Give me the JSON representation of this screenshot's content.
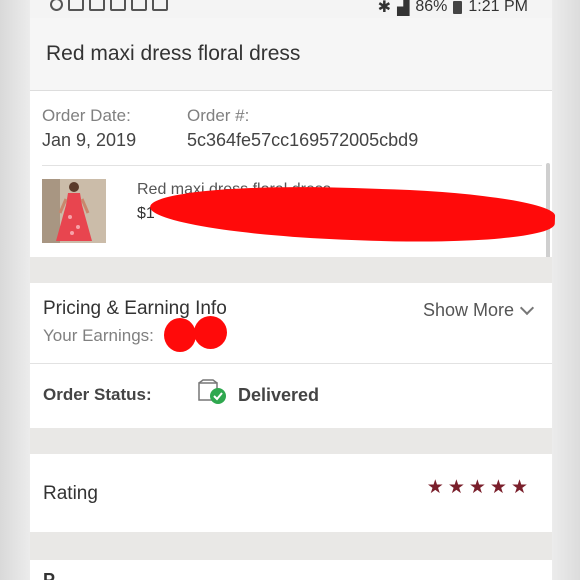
{
  "status_bar": {
    "battery": "86%",
    "time": "1:21 PM"
  },
  "header": {
    "title": "Red maxi dress floral dress"
  },
  "order": {
    "date_label": "Order Date:",
    "date_value": "Jan 9, 2019",
    "number_label": "Order #:",
    "number_value": "5c364fe57cc169572005cbd9",
    "item_name": "Red maxi dress floral dress",
    "item_price_visible": "$1"
  },
  "pricing": {
    "title": "Pricing & Earning Info",
    "earnings_label": "Your Earnings:",
    "show_more": "Show More"
  },
  "status": {
    "label": "Order Status:",
    "value": "Delivered"
  },
  "rating": {
    "label": "Rating",
    "stars": 5,
    "star_color": "#7a1f2b"
  },
  "next_section": {
    "partial_text": "P "
  },
  "colors": {
    "redaction": "#ff0a0a",
    "delivered_check": "#2fa84f",
    "star": "#7a1f2b"
  }
}
